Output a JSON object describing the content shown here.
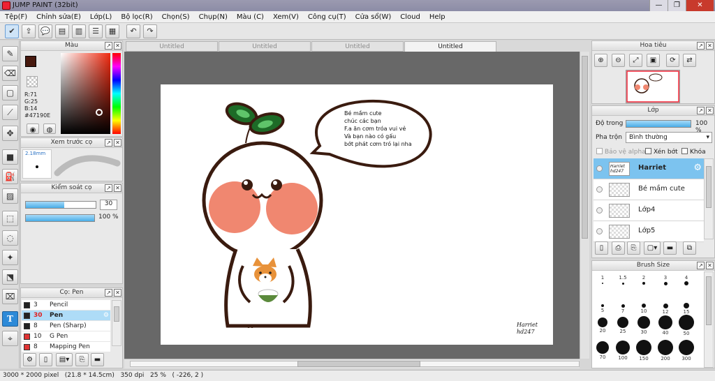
{
  "window": {
    "title": "JUMP PAINT (32bit)",
    "min": "—",
    "max": "❐",
    "close": "✕"
  },
  "menu": [
    "Tệp(F)",
    "Chỉnh sửa(E)",
    "Lớp(L)",
    "Bộ lọc(R)",
    "Chọn(S)",
    "Chụp(N)",
    "Màu (C)",
    "Xem(V)",
    "Công cụ(T)",
    "Cửa sổ(W)",
    "Cloud",
    "Help"
  ],
  "color_panel": {
    "title": "Màu",
    "r": "R:71",
    "g": "G:25",
    "b": "B:14",
    "hex": "#47190E",
    "primary": "#47190e"
  },
  "brush_preview": {
    "title": "Xem trước cọ",
    "size": "2.18mm"
  },
  "brush_control": {
    "title": "Kiểm soát cọ",
    "size_value": "30",
    "size_fill": 0.55,
    "opacity": "100 %",
    "opacity_fill": 1.0
  },
  "brush_list": {
    "title": "Cọ: Pen",
    "items": [
      {
        "size": "3",
        "name": "Pencil",
        "color": "#222222"
      },
      {
        "size": "30",
        "name": "Pen",
        "color": "#222222",
        "selected": true
      },
      {
        "size": "8",
        "name": "Pen (Sharp)",
        "color": "#222222"
      },
      {
        "size": "10",
        "name": "G Pen",
        "color": "#e03434"
      },
      {
        "size": "8",
        "name": "Mapping Pen",
        "color": "#e03434"
      }
    ]
  },
  "tabs": [
    "Untitled",
    "Untitled",
    "Untitled",
    "Untitled"
  ],
  "canvas": {
    "speech": [
      "Bé mầm cute",
      "chúc các bạn",
      "F.a ăn cơm tróa vui vẻ",
      "Và bạn nào có gấu",
      "bớt phát cơm tró lại nha"
    ],
    "signature": [
      "Harriet",
      "hd247"
    ]
  },
  "navigator": {
    "title": "Hoa tiêu"
  },
  "layers": {
    "title": "Lớp",
    "opacity_label": "Độ trong",
    "opacity_value": "100 %",
    "blend_label": "Pha trộn",
    "blend_value": "Bình thường",
    "protect_alpha": "Bảo vệ alpha",
    "clip": "Xén bớt",
    "lock": "Khóa",
    "items": [
      {
        "name": "Harriet",
        "thumb": "Harriet hd247",
        "selected": true
      },
      {
        "name": "Bé mầm cute",
        "thumb": ""
      },
      {
        "name": "Lớp4",
        "thumb": ""
      },
      {
        "name": "Lớp5",
        "thumb": ""
      }
    ]
  },
  "brush_size": {
    "title": "Brush Size",
    "rows": [
      [
        "1",
        "1.5",
        "2",
        "3",
        "4"
      ],
      [
        "5",
        "7",
        "10",
        "12",
        "15"
      ],
      [
        "20",
        "25",
        "30",
        "40",
        "50"
      ],
      [
        "70",
        "100",
        "150",
        "200",
        "300"
      ]
    ]
  },
  "status": {
    "dims": "3000 * 2000 pixel",
    "cm": "(21.8 * 14.5cm)",
    "dpi": "350 dpi",
    "zoom": "25 %",
    "coord": "( -226, 2 )"
  }
}
